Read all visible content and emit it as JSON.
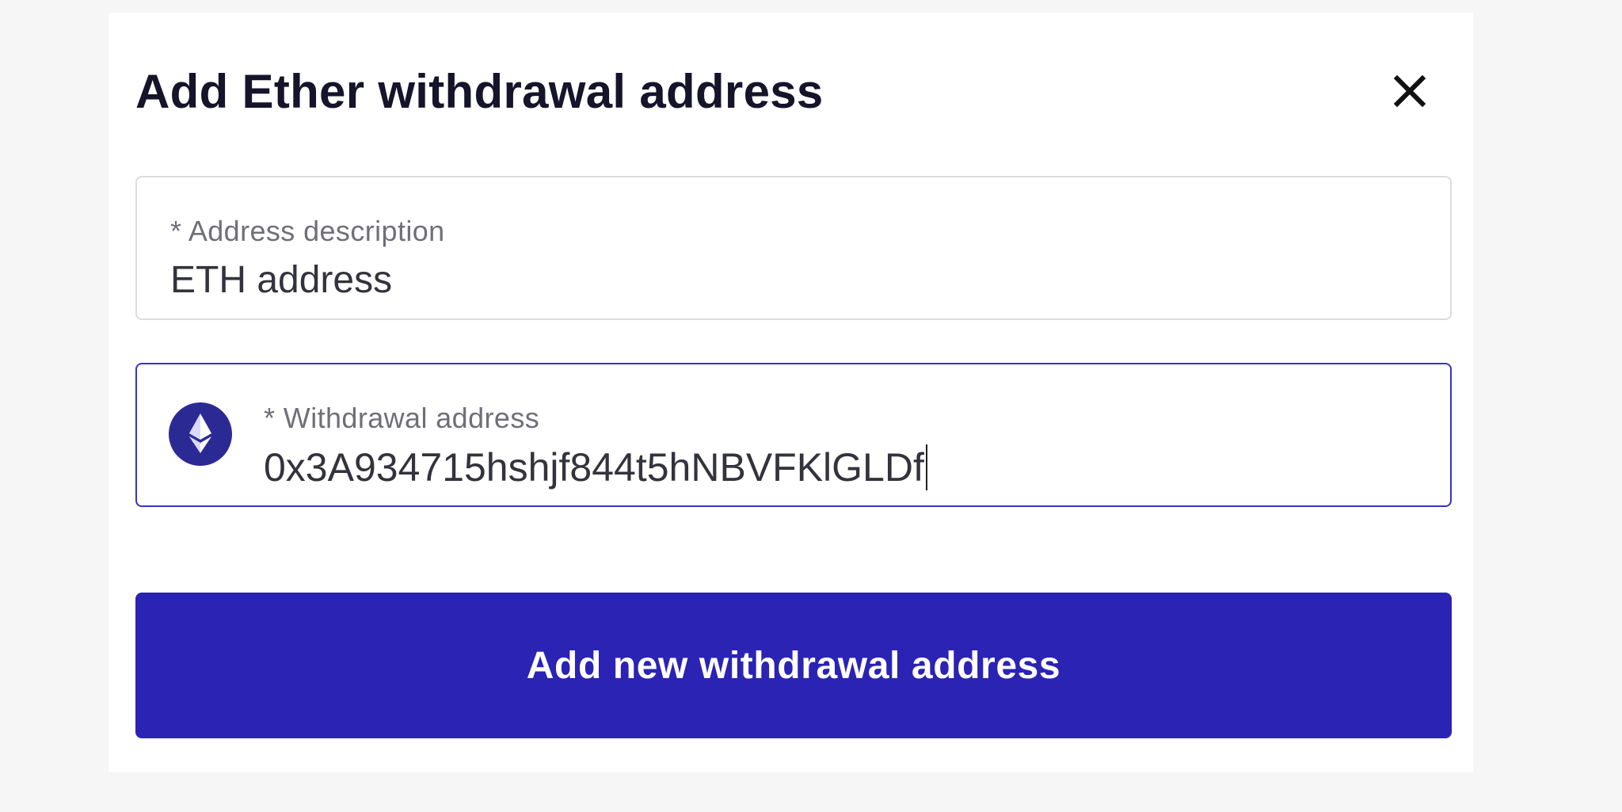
{
  "dialog": {
    "title": "Add Ether withdrawal address",
    "close_icon": "close-icon"
  },
  "description_field": {
    "label": "* Address description",
    "value": "ETH address"
  },
  "address_field": {
    "label": "* Withdrawal address",
    "value": "0x3A934715hshjf844t5hNBVFKlGLDf",
    "icon": "ethereum-icon",
    "focused": true
  },
  "submit": {
    "label": "Add new withdrawal address"
  },
  "colors": {
    "primary": "#2a23b4",
    "focus_border": "#3a33c9",
    "eth_badge": "#2b2a95",
    "title_text": "#15142a",
    "label_text": "#6f6f78",
    "value_text": "#33333d",
    "page_bg": "#f6f6f6"
  }
}
